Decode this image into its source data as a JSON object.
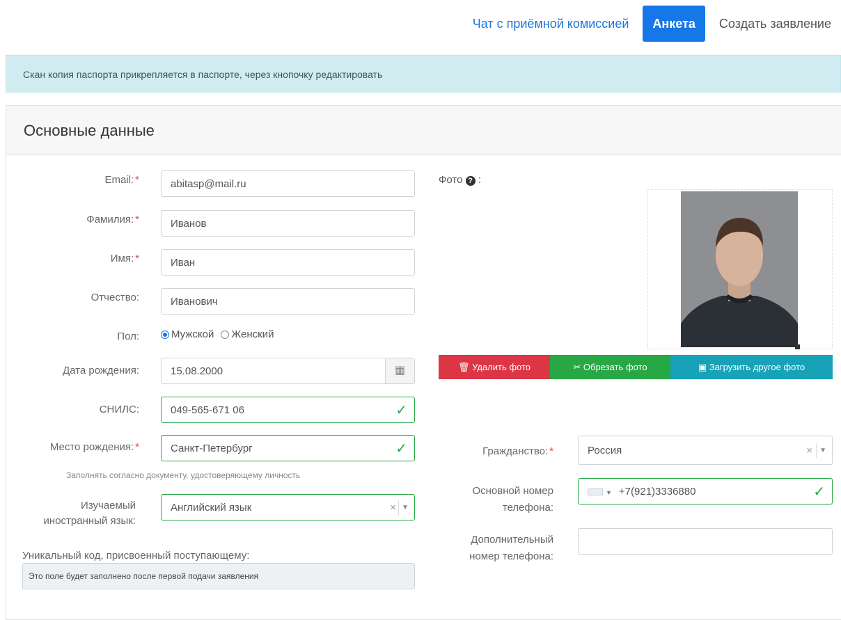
{
  "nav": {
    "chat": "Чат с приёмной комиссией",
    "profile": "Анкета",
    "create": "Создать заявление"
  },
  "alert": "Скан копия паспорта прикрепляется в паспорте, через кнопочку редактировать",
  "card_title": "Основные данные",
  "form": {
    "email_label": "Email:",
    "email_value": "abitasp@mail.ru",
    "surname_label": "Фамилия:",
    "surname_value": "Иванов",
    "name_label": "Имя:",
    "name_value": "Иван",
    "patronymic_label": "Отчество:",
    "patronymic_value": "Иванович",
    "gender_label": "Пол:",
    "gender_male": "Мужской",
    "gender_female": "Женский",
    "birthdate_label": "Дата рождения:",
    "birthdate_value": "15.08.2000",
    "snils_label": "СНИЛС:",
    "snils_value": "049-565-671 06",
    "birthplace_label": "Место рождения:",
    "birthplace_value": "Санкт-Петербург",
    "birthplace_hint": "Заполнять согласно документу, удостоверяющему личность",
    "language_label_1": "Изучаемый",
    "language_label_2": "иностранный язык:",
    "language_value": "Английский язык",
    "unique_code_label": "Уникальный код, присвоенный поступающему:",
    "unique_code_value": "Это поле будет заполнено после первой подачи заявления",
    "required_mark": "*"
  },
  "photo": {
    "label": "Фото",
    "delete": "Удалить фото",
    "crop": "Обрезать фото",
    "upload": "Загрузить другое фото"
  },
  "right": {
    "citizenship_label": "Гражданство:",
    "citizenship_value": "Россия",
    "phone_label_1": "Основной номер",
    "phone_label_2": "телефона:",
    "phone_value": "+7(921)3336880",
    "extra_phone_label_1": "Дополнительный",
    "extra_phone_label_2": "номер телефона:"
  }
}
